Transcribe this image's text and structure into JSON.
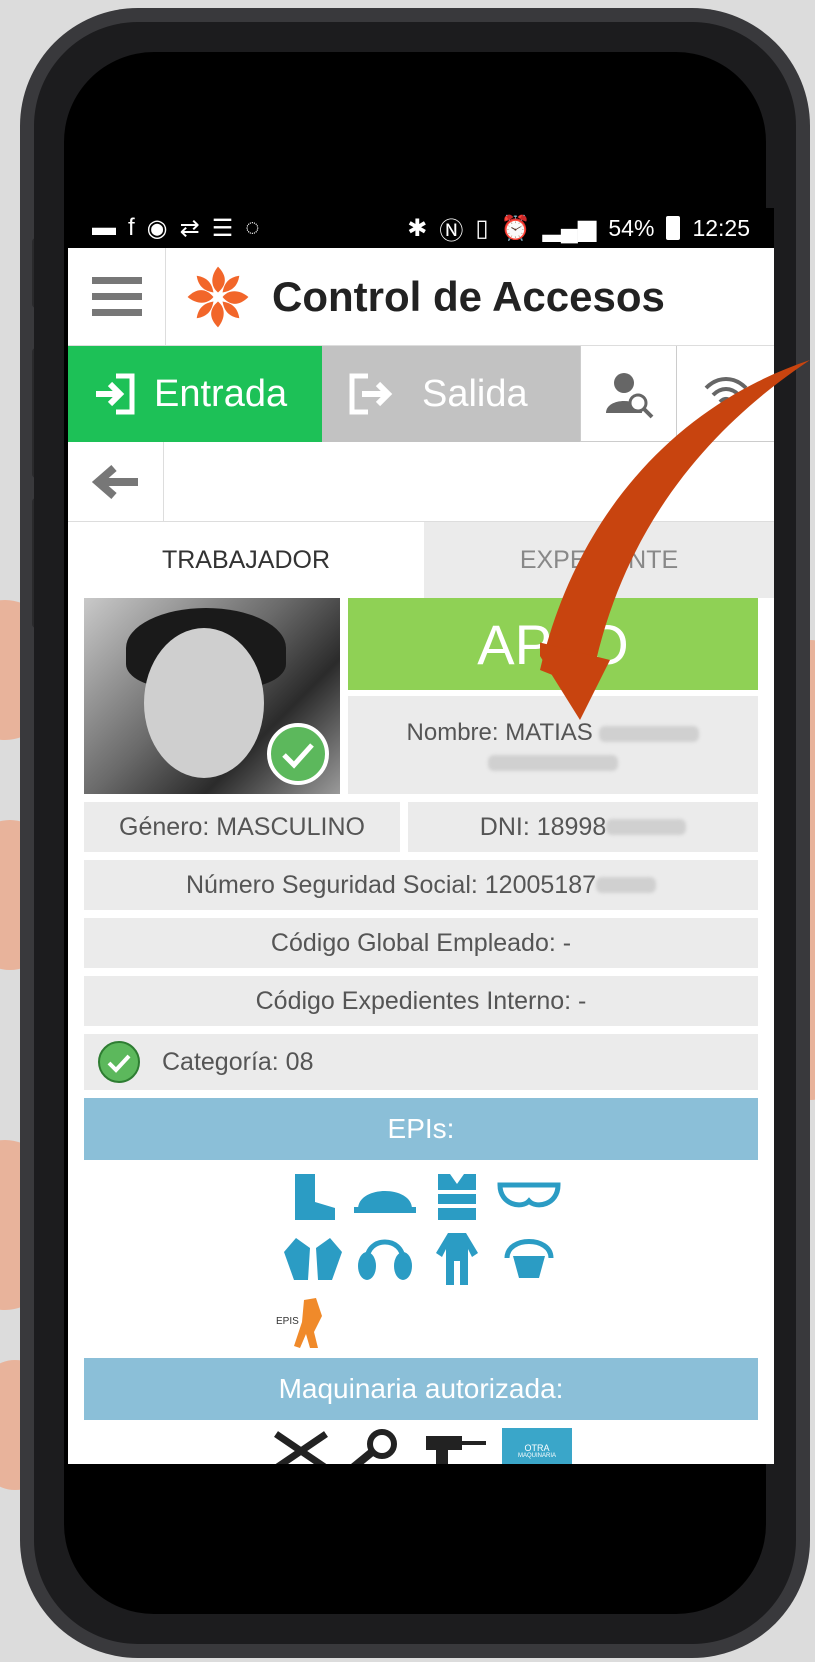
{
  "status_bar": {
    "battery": "54%",
    "time": "12:25"
  },
  "app": {
    "title": "Control de Accesos"
  },
  "mode": {
    "entrada_label": "Entrada",
    "salida_label": "Salida"
  },
  "tabs": [
    {
      "label": "TRABAJADOR",
      "active": true
    },
    {
      "label": "EXPEDIENTE",
      "active": false
    }
  ],
  "worker": {
    "status": "APTO",
    "nombre": "Nombre: MATIAS",
    "genero": "Género: MASCULINO",
    "dni": "DNI: 18998",
    "nss": "Número Seguridad Social: 12005187",
    "codigo_global": "Código Global Empleado: -",
    "codigo_expedientes": "Código Expedientes Interno: -",
    "categoria": "Categoría: 08"
  },
  "sections": {
    "epis": "EPIs:",
    "maquinaria": "Maquinaria autorizada:"
  },
  "epi_icons": [
    "boots-icon",
    "helmet-icon",
    "vest-icon",
    "goggles-icon",
    "gloves-icon",
    "ear-protection-icon",
    "coverall-icon",
    "mask-icon",
    "fall-harness-icon"
  ],
  "maquinaria_icons": [
    "tools-icon",
    "grinder-icon",
    "drill-icon"
  ],
  "otra_maquinaria": {
    "line1": "OTRA",
    "line2": "MAQUINARIA"
  },
  "colors": {
    "entrada_green": "#1dc157",
    "apto_green": "#8fd155",
    "section_blue": "#8bbfd8",
    "icon_blue": "#2b9cc4",
    "arrow_orange": "#c8440f",
    "logo_orange": "#f2662a"
  }
}
